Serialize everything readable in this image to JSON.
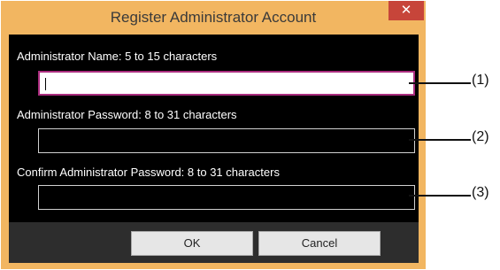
{
  "dialog": {
    "title": "Register Administrator Account",
    "close_glyph": "✕",
    "fields": [
      {
        "label": "Administrator Name:  5 to 15 characters",
        "value": "",
        "callout": "(1)"
      },
      {
        "label": "Administrator Password:  8 to 31 characters",
        "value": "",
        "callout": "(2)"
      },
      {
        "label": "Confirm Administrator Password:  8 to 31 characters",
        "value": "",
        "callout": "(3)"
      }
    ],
    "ok_label": "OK",
    "cancel_label": "Cancel"
  },
  "colors": {
    "frame": "#f2b661",
    "close_button": "#c7453a",
    "focus_border": "#ab2d7f",
    "content_bg": "#000000",
    "footer_bg": "#2d2d2d"
  }
}
